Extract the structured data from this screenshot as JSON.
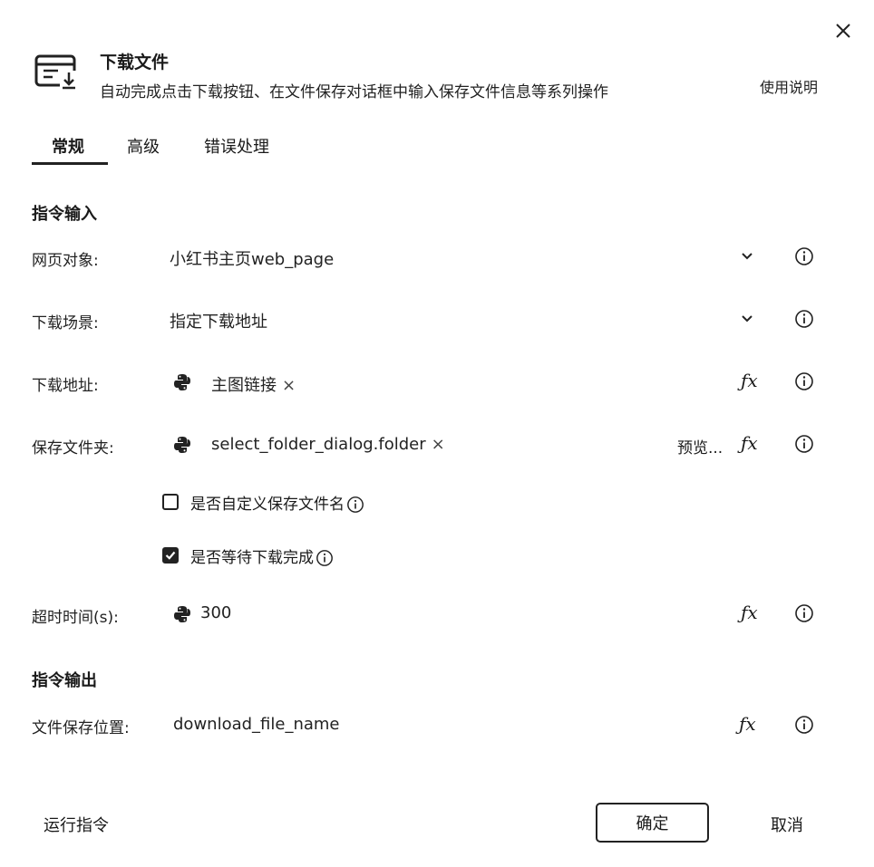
{
  "dialog": {
    "title": "下载文件",
    "subtitle": "自动完成点击下载按钮、在文件保存对话框中输入保存文件信息等系列操作",
    "help_link": "使用说明",
    "header_icon": "download-window-icon",
    "close_icon": "close-icon"
  },
  "tabs": [
    {
      "label": "常规",
      "active": true
    },
    {
      "label": "高级",
      "active": false
    },
    {
      "label": "错误处理",
      "active": false
    }
  ],
  "input_section": {
    "title": "指令输入",
    "web_object": {
      "label": "网页对象:",
      "value": "小红书主页web_page"
    },
    "download_scene": {
      "label": "下载场景:",
      "value": "指定下载地址"
    },
    "download_url": {
      "label": "下载地址:",
      "value": "主图链接",
      "remove": "×"
    },
    "save_folder": {
      "label": "保存文件夹:",
      "value": "select_folder_dialog.folder",
      "remove": "×",
      "preview": "预览..."
    },
    "custom_filename": {
      "label": "是否自定义保存文件名",
      "checked": false
    },
    "wait_complete": {
      "label": "是否等待下载完成",
      "checked": true
    },
    "timeout": {
      "label": "超时时间(s):",
      "value": "300"
    },
    "fx_label": "ƒx"
  },
  "output_section": {
    "title": "指令输出",
    "file_location": {
      "label": "文件保存位置:",
      "value": "download_file_name"
    }
  },
  "footer": {
    "run": "运行指令",
    "confirm": "确定",
    "cancel": "取消"
  }
}
